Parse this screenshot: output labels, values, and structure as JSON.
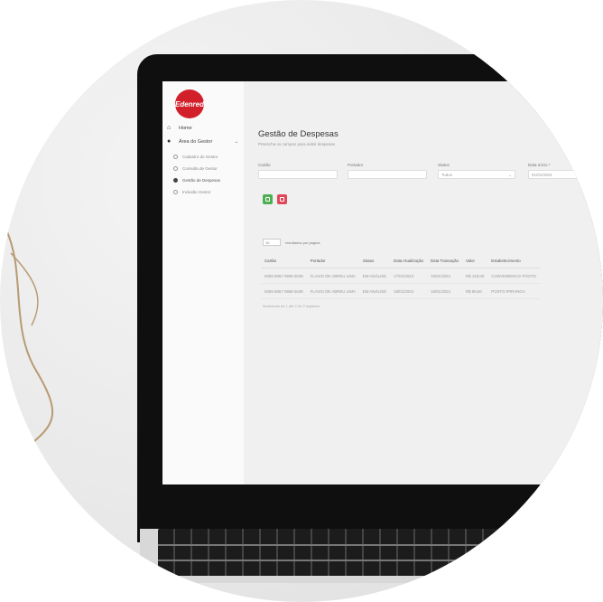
{
  "brand": {
    "logo_text": "Edenred",
    "color": "#d2202b"
  },
  "sidebar": {
    "items": [
      {
        "label": "Home",
        "icon": "home-icon"
      },
      {
        "label": "Área do Gestor",
        "icon": "user-icon",
        "chevron": "chevron-down-icon"
      }
    ],
    "subitems": [
      {
        "label": "Cadastro do Gestor"
      },
      {
        "label": "Consulta de Gestor"
      },
      {
        "label": "Gestão de Despesas",
        "active": true
      },
      {
        "label": "Inclusão Gestor"
      }
    ]
  },
  "page": {
    "title": "Gestão de Despesas",
    "subtitle": "Preencha os campos para exibir despesas"
  },
  "filters": {
    "cartao_label": "Cartão",
    "portador_label": "Portador",
    "status_label": "Status",
    "status_value": "Todos",
    "data_inicio_label": "Data Início *",
    "data_inicio_value": "01/01/2024"
  },
  "perpage": {
    "value": "10",
    "label": "resultados por página"
  },
  "table": {
    "headers": [
      "Cartão",
      "Portador",
      "Status",
      "Data Atualização",
      "Data Transação",
      "Valor",
      "Estabelecimento"
    ],
    "rows": [
      [
        "5055 8957 0968 5048",
        "FLAVIO DE ABREU LIMA",
        "EM ANÁLISE",
        "17/01/2024",
        "15/01/2024",
        "R$ 120,00",
        "CONVENIENCIA POSTO"
      ],
      [
        "5055 8957 0968 5048",
        "FLAVIO DE ABREU LIMA",
        "EM ANÁLISE",
        "18/01/2024",
        "16/01/2024",
        "R$ 89,50",
        "POSTO IPIRANGA"
      ]
    ]
  },
  "info": "Mostrando de 1 até 2 de 2 registros"
}
